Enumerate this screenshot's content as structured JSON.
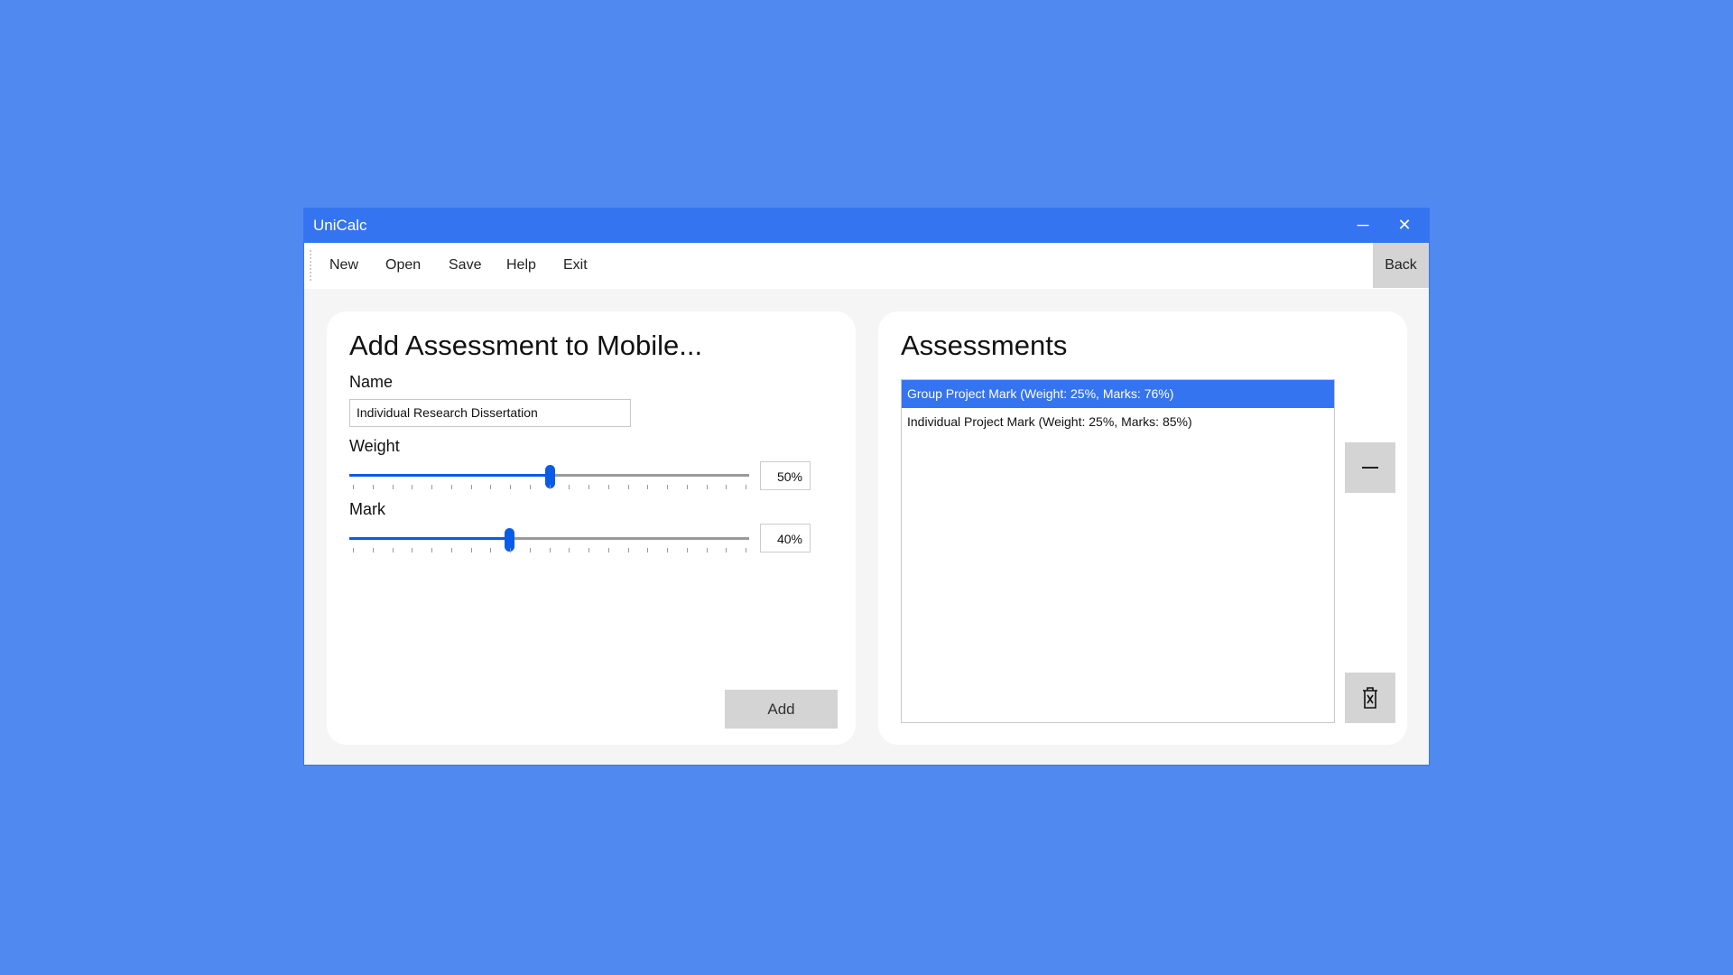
{
  "window": {
    "title": "UniCalc",
    "minimize_label": "─",
    "close_label": "✕"
  },
  "menu": {
    "items": [
      "New",
      "Open",
      "Save",
      "Help",
      "Exit"
    ],
    "back_label": "Back"
  },
  "add_panel": {
    "title": "Add Assessment to Mobile...",
    "name_label": "Name",
    "name_value": "Individual Research Dissertation",
    "weight_label": "Weight",
    "weight_value": 50,
    "weight_text": "50%",
    "mark_label": "Mark",
    "mark_value": 40,
    "mark_text": "40%",
    "add_label": "Add"
  },
  "assessments_panel": {
    "title": "Assessments",
    "items": [
      "Group Project Mark (Weight: 25%, Marks: 76%)",
      "Individual Project Mark (Weight: 25%, Marks: 85%)"
    ],
    "selected_index": 0
  },
  "colors": {
    "accent": "#3574f0",
    "background": "#5089ef"
  }
}
